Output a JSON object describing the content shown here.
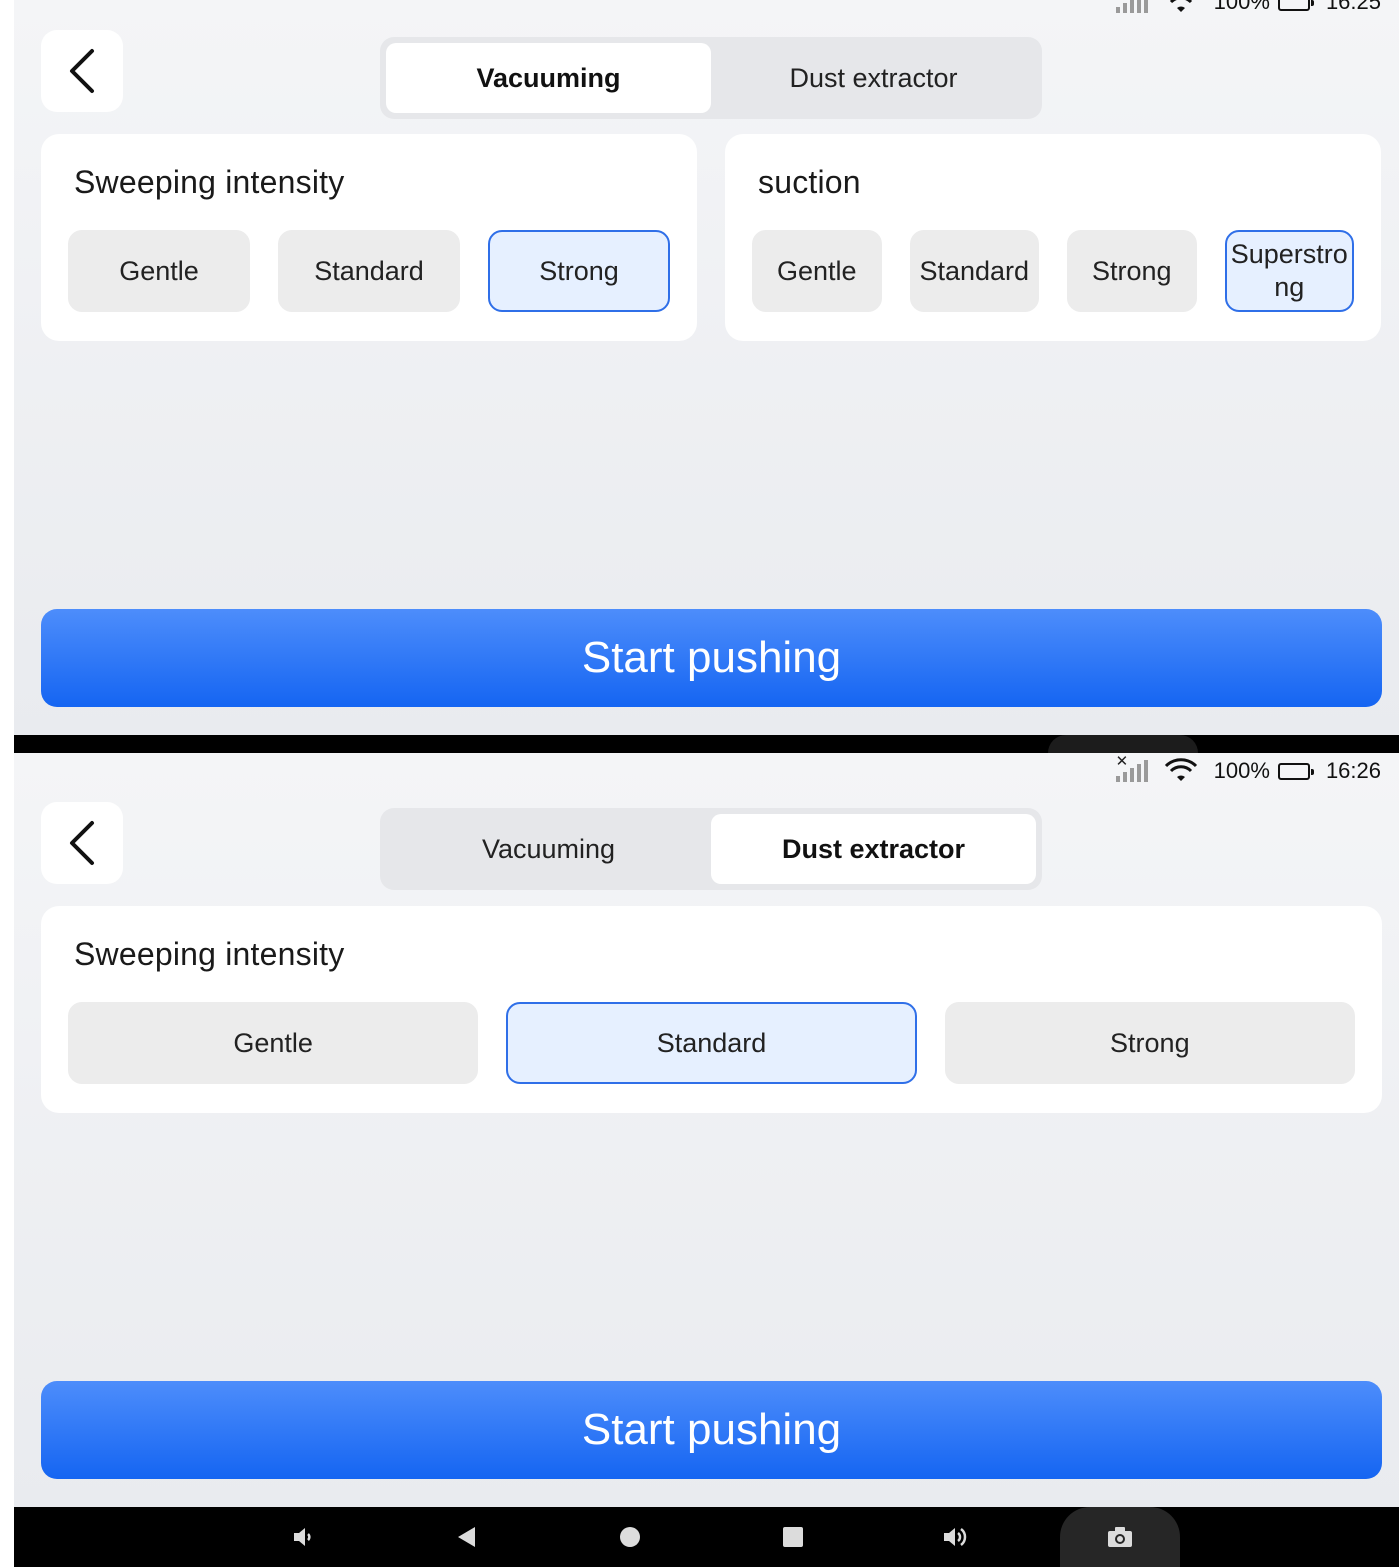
{
  "status_bar": {
    "battery": "100%",
    "time": "16:26"
  },
  "screens": [
    {
      "tabs": [
        {
          "label": "Vacuuming",
          "active": true
        },
        {
          "label": "Dust extractor",
          "active": false
        }
      ],
      "cards": [
        {
          "title": "Sweeping intensity",
          "options": [
            "Gentle",
            "Standard",
            "Strong"
          ],
          "selected": "Strong"
        },
        {
          "title": "suction",
          "options": [
            "Gentle",
            "Standard",
            "Strong",
            "Superstro\nng"
          ],
          "selected": "Superstro\nng"
        }
      ],
      "start_label": "Start pushing"
    },
    {
      "tabs": [
        {
          "label": "Vacuuming",
          "active": false
        },
        {
          "label": "Dust extractor",
          "active": true
        }
      ],
      "cards": [
        {
          "title": "Sweeping intensity",
          "options": [
            "Gentle",
            "Standard",
            "Strong"
          ],
          "selected": "Standard"
        }
      ],
      "start_label": "Start pushing"
    }
  ],
  "navbar": {
    "items": [
      {
        "name": "volume-down-icon",
        "glyph": "🔉"
      },
      {
        "name": "back-icon",
        "glyph": "◀"
      },
      {
        "name": "home-icon",
        "glyph": "●"
      },
      {
        "name": "recents-icon",
        "glyph": "■"
      },
      {
        "name": "volume-up-icon",
        "glyph": "🔊"
      },
      {
        "name": "camera-icon",
        "glyph": "camera"
      }
    ]
  },
  "colors": {
    "accent": "#1565f2",
    "selected_bg": "#e6f0ff",
    "selected_border": "#2f6fe8",
    "option_bg": "#ececec"
  }
}
